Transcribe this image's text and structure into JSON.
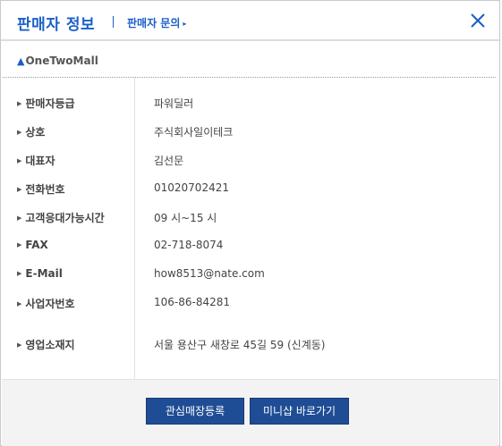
{
  "header": {
    "title": "판매자 정보",
    "inquiry_link": "판매자 문의",
    "inquiry_arrow": "▸"
  },
  "shop": {
    "home_icon": "▲",
    "name": "OneTwoMall"
  },
  "info": {
    "rows": [
      {
        "label": "판매자등급",
        "value": "파워딜러"
      },
      {
        "label": "상호",
        "value": "주식회사일이테크"
      },
      {
        "label": "대표자",
        "value": "김선문"
      },
      {
        "label": "전화번호",
        "value": "01020702421"
      },
      {
        "label": "고객응대가능시간",
        "value": "09 시~15 시"
      },
      {
        "label": "FAX",
        "value": "02-718-8074"
      },
      {
        "label": "E-Mail",
        "value": "how8513@nate.com"
      },
      {
        "label": "사업자번호",
        "value": "106-86-84281"
      },
      {
        "label": "영업소재지",
        "value": "서울 용산구 새창로 45길 59 (신계동)"
      }
    ]
  },
  "buttons": {
    "add_favorite": "관심매장등록",
    "go_minishop": "미니샵 바로가기"
  },
  "colors": {
    "accent": "#1a5fc8",
    "button_bg": "#1f4d95",
    "footer_bg": "#f3f3f3"
  }
}
